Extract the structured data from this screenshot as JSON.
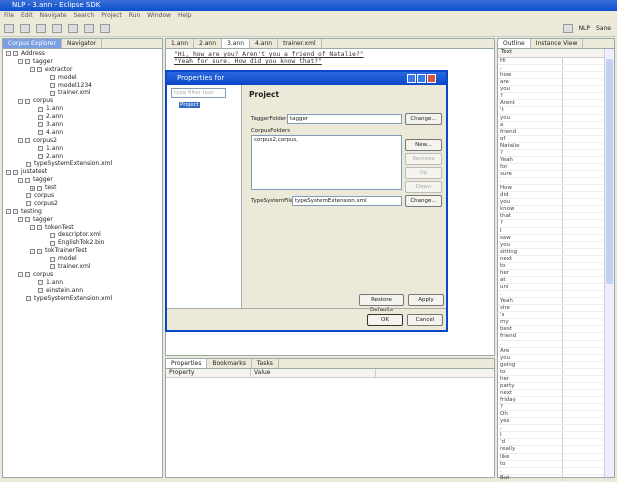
{
  "window": {
    "title": "NLP - 3.ann - Eclipse SDK"
  },
  "menu": [
    "File",
    "Edit",
    "Navigate",
    "Search",
    "Project",
    "Run",
    "Window",
    "Help"
  ],
  "perspectives": [
    "NLP",
    "Sane"
  ],
  "explorer": {
    "tabs": [
      "Corpus Explorer",
      "Navigator"
    ],
    "tree": [
      {
        "label": "Address",
        "level": 0,
        "exp": "-"
      },
      {
        "label": "tagger",
        "level": 1,
        "exp": "-"
      },
      {
        "label": "extractor",
        "level": 2,
        "exp": "-"
      },
      {
        "label": "model",
        "level": 3
      },
      {
        "label": "model1234",
        "level": 3
      },
      {
        "label": "trainer.xml",
        "level": 3
      },
      {
        "label": "corpus",
        "level": 1,
        "exp": "-"
      },
      {
        "label": "1.ann",
        "level": 2
      },
      {
        "label": "2.ann",
        "level": 2
      },
      {
        "label": "3.ann",
        "level": 2
      },
      {
        "label": "4.ann",
        "level": 2
      },
      {
        "label": "corpus2",
        "level": 1,
        "exp": "-"
      },
      {
        "label": "1.ann",
        "level": 2
      },
      {
        "label": "2.ann",
        "level": 2
      },
      {
        "label": "typeSystemExtension.xml",
        "level": 1
      },
      {
        "label": "justatest",
        "level": 0,
        "exp": "-"
      },
      {
        "label": "tagger",
        "level": 1,
        "exp": "-"
      },
      {
        "label": "test",
        "level": 2,
        "exp": "+"
      },
      {
        "label": "corpus",
        "level": 1
      },
      {
        "label": "corpus2",
        "level": 1
      },
      {
        "label": "testing",
        "level": 0,
        "exp": "-"
      },
      {
        "label": "tagger",
        "level": 1,
        "exp": "-"
      },
      {
        "label": "tokenTest",
        "level": 2,
        "exp": "-"
      },
      {
        "label": "descriptor.xml",
        "level": 3
      },
      {
        "label": "EnglishTok2.bin",
        "level": 3
      },
      {
        "label": "tokTrainerTest",
        "level": 2,
        "exp": "-"
      },
      {
        "label": "model",
        "level": 3
      },
      {
        "label": "trainer.xml",
        "level": 3
      },
      {
        "label": "corpus",
        "level": 1,
        "exp": "-"
      },
      {
        "label": "1.ann",
        "level": 2
      },
      {
        "label": "einstein.ann",
        "level": 2
      },
      {
        "label": "typeSystemExtension.xml",
        "level": 1
      }
    ]
  },
  "editor": {
    "tabs": [
      "1.ann",
      "2.ann",
      "3.ann",
      "4.ann",
      "trainer.xml"
    ],
    "active": 2,
    "lines": [
      "\"Hi, how are you? Aren't you a friend of Natalie?\"",
      "\"Yeah for sure. How did you know that?\""
    ]
  },
  "dialog": {
    "title": "Properties for",
    "filter_placeholder": "type filter text",
    "nav_item": "Project",
    "heading": "Project",
    "tagger_label": "TaggerFolder",
    "tagger_value": "tagger",
    "corpus_label": "CorpusFolders",
    "corpus_value": "corpus2,corpus,",
    "type_label": "TypeSystemFile",
    "type_value": "typeSystemExtension.xml",
    "change": "Change...",
    "new": "New...",
    "remove": "Remove",
    "up": "Up",
    "down": "Down",
    "restore": "Restore Defaults",
    "apply": "Apply",
    "ok": "OK",
    "cancel": "Cancel"
  },
  "properties": {
    "tabs": [
      "Properties",
      "Bookmarks",
      "Tasks"
    ],
    "columns": [
      "Property",
      "Value"
    ]
  },
  "outline": {
    "tabs": [
      "Outline",
      "Instance View"
    ],
    "column": "Text",
    "items": [
      "Hi",
      ",",
      "how",
      "are",
      "you",
      "?",
      "Arent",
      "'t",
      "you",
      "a",
      "friend",
      "of",
      "Natalie",
      "?",
      "Yeah",
      "for",
      "sure",
      ".",
      "How",
      "did",
      "you",
      "know",
      "that",
      "?",
      "I",
      "saw",
      "you",
      "sitting",
      "next",
      "to",
      "her",
      "at",
      "uni",
      ".",
      "Yeah",
      "she",
      "'s",
      "my",
      "best",
      "friend",
      ".",
      "Are",
      "you",
      "going",
      "to",
      "her",
      "party",
      "next",
      "friday",
      "?",
      "Oh",
      "yes",
      ",",
      "I",
      "'d",
      "really",
      "like",
      "to",
      ".",
      "But"
    ]
  }
}
